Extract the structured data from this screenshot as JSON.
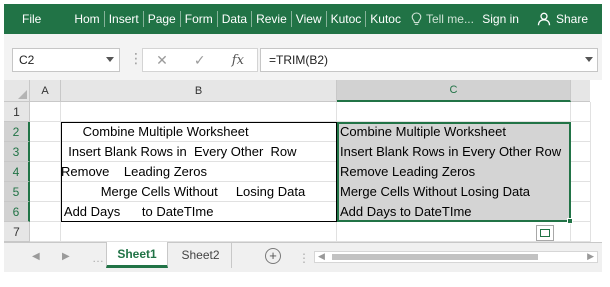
{
  "ribbon": {
    "file": "File",
    "tabs": [
      "Hom",
      "Insert",
      "Page",
      "Form",
      "Data",
      "Revie",
      "View",
      "Kutoc",
      "Kutoc"
    ],
    "tell_me": "Tell me...",
    "sign_in": "Sign in",
    "share": "Share",
    "color": "#217346"
  },
  "formula_bar": {
    "name_box": "C2",
    "cancel_glyph": "✕",
    "enter_glyph": "✓",
    "fx": "fx",
    "formula": "=TRIM(B2)"
  },
  "columns": [
    "A",
    "B",
    "C"
  ],
  "rows": [
    "1",
    "2",
    "3",
    "4",
    "5",
    "6",
    "7"
  ],
  "column_b": [
    "      Combine Multiple Worksheet",
    "  Insert Blank Rows in  Every Other  Row",
    "Remove    Leading Zeros",
    "           Merge Cells Without     Losing Data",
    " Add Days      to DateTIme"
  ],
  "column_c": [
    "Combine Multiple Worksheet",
    "Insert Blank Rows in Every Other Row",
    "Remove Leading Zeros",
    "Merge Cells Without Losing Data",
    "Add Days to DateTIme"
  ],
  "sheet_tabs": {
    "active": "Sheet1",
    "other": "Sheet2"
  }
}
